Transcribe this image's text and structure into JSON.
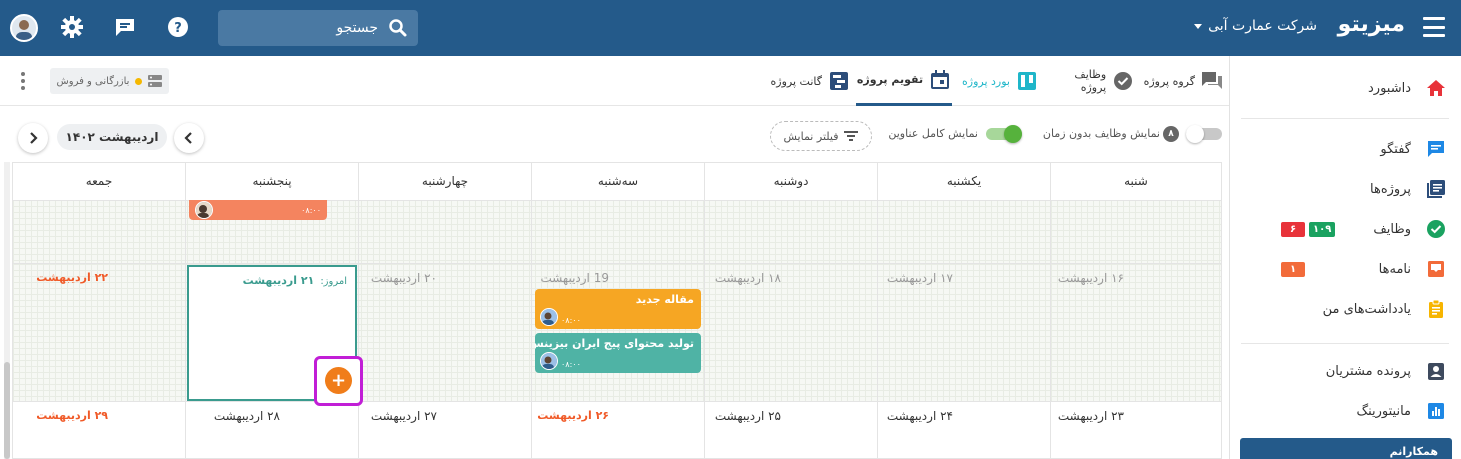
{
  "topbar": {
    "brand": "میزیتو",
    "company": "شرکت عمارت آبی",
    "search_placeholder": "جستجو",
    "icons": [
      "menu-icon",
      "search-icon",
      "help-icon",
      "chat-icon",
      "gear-icon"
    ],
    "color": "#245a8a"
  },
  "sidebar": {
    "items": [
      {
        "label": "داشبورد",
        "icon": "home-icon"
      },
      {
        "label": "گفتگو",
        "icon": "chat-icon"
      },
      {
        "label": "پروژه‌ها",
        "icon": "projects-icon"
      },
      {
        "label": "وظایف",
        "icon": "check-icon",
        "badges": [
          "۱۰۹",
          "۶"
        ]
      },
      {
        "label": "نامه‌ها",
        "icon": "inbox-icon",
        "badges": [
          "۱"
        ]
      },
      {
        "label": "یادداشت‌های من",
        "icon": "notes-icon"
      },
      {
        "label": "پرونده مشتریان",
        "icon": "contacts-icon"
      },
      {
        "label": "مانیتورینگ",
        "icon": "monitoring-icon"
      }
    ],
    "colleagues": "همکارانم"
  },
  "tabs": [
    {
      "label": "گروه پروژه",
      "icon": "group-chat-icon"
    },
    {
      "label": "وظایف پروژه",
      "icon": "task-check-icon"
    },
    {
      "label": "بورد پروژه",
      "icon": "board-icon"
    },
    {
      "label": "تقویم پروژه",
      "icon": "calendar-icon",
      "active": true
    },
    {
      "label": "گانت پروژه",
      "icon": "gantt-icon"
    }
  ],
  "workspace_chip": "بازرگانی و فروش",
  "toolbar": {
    "no_time_count": "۸",
    "no_time_label": "نمایش وظایف بدون زمان",
    "full_titles_label": "نمایش کامل عناوین",
    "filter_label": "فیلتر نمایش",
    "month": "اردیبهشت ۱۴۰۲"
  },
  "calendar": {
    "weekdays": [
      "شنبه",
      "یکشنبه",
      "دوشنبه",
      "سه‌شنبه",
      "چهارشنبه",
      "پنجشنبه",
      "جمعه"
    ],
    "week1": [
      "۱۶ اردیبهشت",
      "۱۷ اردیبهشت",
      "۱۸ اردیبهشت",
      "19 اردیبهشت",
      "۲۰ اردیبهشت",
      "۲۱ اردیبهشت",
      "۲۲ اردیبهشت"
    ],
    "week2": [
      "۲۳ اردیبهشت",
      "۲۴ اردیبهشت",
      "۲۵ اردیبهشت",
      "۲۶ اردیبهشت",
      "۲۷ اردیبهشت",
      "۲۸ اردیبهشت",
      "۲۹ اردیبهشت"
    ],
    "today_prefix": "امروز:",
    "today_date": "۲۱ اردیبهشت",
    "tasks": [
      {
        "title": "",
        "time": "۰۸:۰۰",
        "color": "#f4845f"
      },
      {
        "title": "مقاله جدید",
        "time": "۰۸:۰۰",
        "color": "#f6a623"
      },
      {
        "title": "تولید محتوای پیج ایران بیزینس",
        "time": "۰۸:۰۰",
        "color": "#4fb3a5"
      }
    ],
    "add_button": "+"
  },
  "colors": {
    "accent": "#245a8a",
    "today": "#3a9b8e",
    "red": "#f05a28",
    "highlight": "#c11ed6",
    "add": "#f07d1a"
  }
}
